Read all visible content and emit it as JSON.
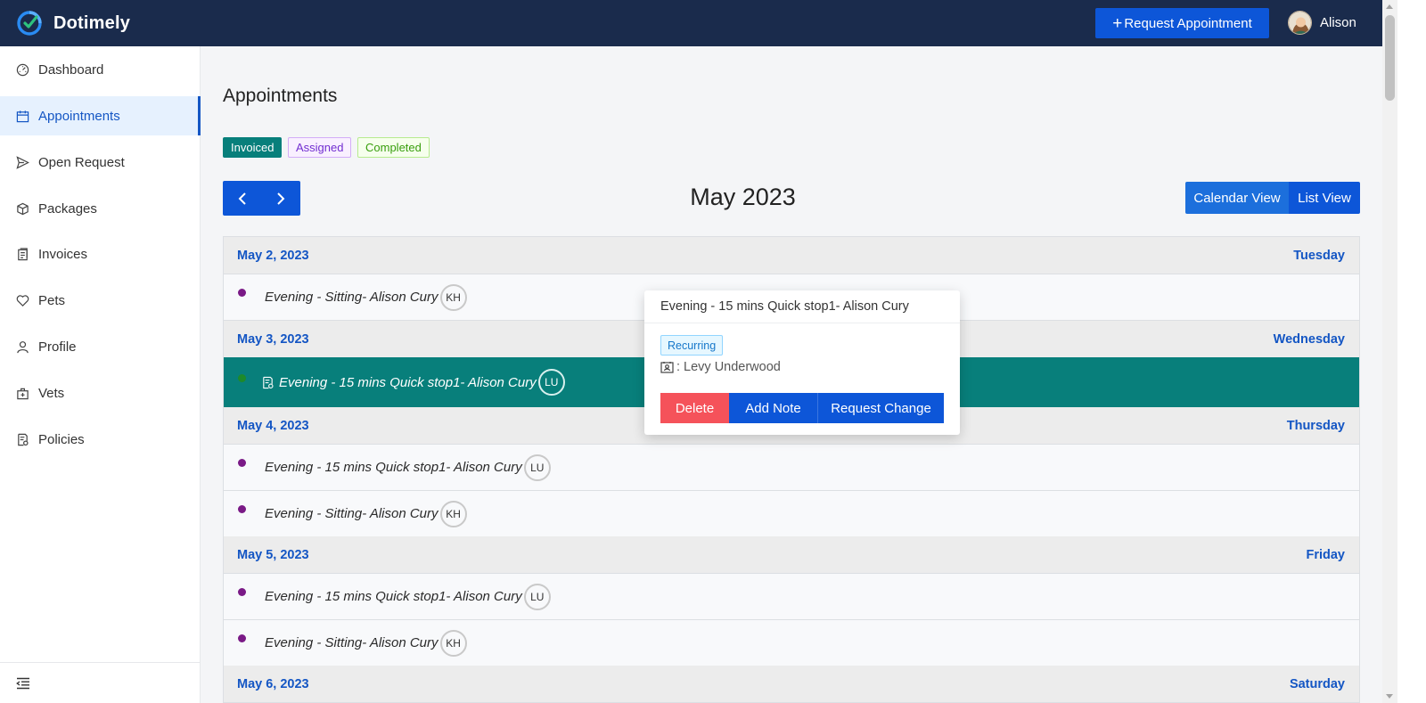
{
  "app": {
    "name": "Dotimely"
  },
  "header": {
    "request_button_label": "Request Appointment",
    "user_name": "Alison"
  },
  "sidebar": {
    "items": [
      {
        "label": "Dashboard",
        "icon": "dashboard-icon"
      },
      {
        "label": "Appointments",
        "icon": "calendar-icon",
        "active": true
      },
      {
        "label": "Open Request",
        "icon": "send-icon"
      },
      {
        "label": "Packages",
        "icon": "package-icon"
      },
      {
        "label": "Invoices",
        "icon": "invoice-icon"
      },
      {
        "label": "Pets",
        "icon": "heart-icon"
      },
      {
        "label": "Profile",
        "icon": "user-icon"
      },
      {
        "label": "Vets",
        "icon": "medical-bag-icon"
      },
      {
        "label": "Policies",
        "icon": "policy-icon"
      }
    ],
    "collapse_icon": "menu-fold-icon"
  },
  "page": {
    "title": "Appointments",
    "legend": [
      "Invoiced",
      "Assigned",
      "Completed"
    ],
    "month": "May 2023",
    "views": {
      "calendar": "Calendar View",
      "list": "List View"
    }
  },
  "days": [
    {
      "date": "May 2, 2023",
      "weekday": "Tuesday"
    },
    {
      "date": "May 3, 2023",
      "weekday": "Wednesday"
    },
    {
      "date": "May 4, 2023",
      "weekday": "Thursday"
    },
    {
      "date": "May 5, 2023",
      "weekday": "Friday"
    },
    {
      "date": "May 6, 2023",
      "weekday": "Saturday"
    }
  ],
  "appointments": [
    {
      "title": "Evening - Sitting- Alison Cury",
      "staff": "KH"
    },
    {
      "title": "Evening - 15 mins Quick stop1- Alison Cury",
      "staff": "LU"
    },
    {
      "title": "Evening - 15 mins Quick stop1- Alison Cury",
      "staff": "LU"
    },
    {
      "title": "Evening - Sitting- Alison Cury",
      "staff": "KH"
    },
    {
      "title": "Evening - 15 mins Quick stop1- Alison Cury",
      "staff": "LU"
    },
    {
      "title": "Evening - Sitting- Alison Cury",
      "staff": "KH"
    }
  ],
  "popover": {
    "title": "Evening - 15 mins Quick stop1- Alison Cury",
    "tag": "Recurring",
    "staff_name": "Levy Underwood",
    "actions": {
      "delete": "Delete",
      "note": "Add Note",
      "change": "Request Change"
    }
  },
  "colors": {
    "header_bg": "#1a2b4c",
    "primary": "#0d56d8",
    "invoiced": "#087f7b",
    "danger": "#f5525a",
    "day_label": "#1456c4"
  }
}
